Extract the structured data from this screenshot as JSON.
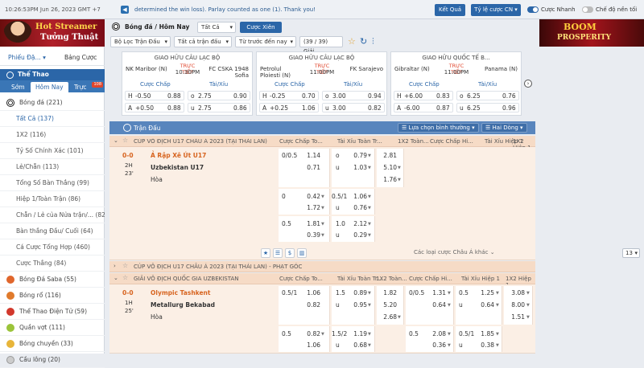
{
  "topbar": {
    "time": "10:26:53PM Jun 26, 2023 GMT +7",
    "marquee": "determined the win loss). Parlay counted as one (1). Thank you!",
    "result_btn": "Kết Quả",
    "odds_type": "Tỷ lệ cược CN",
    "fast_bet": "Cược Nhanh",
    "lite_mode": "Chế độ nền tối"
  },
  "banners": {
    "left_line1": "Hot Streamer",
    "left_line2": "Tưởng Thuật",
    "right_line1": "BOOM",
    "right_line2": "PROSPERITY"
  },
  "sidebar": {
    "tab1": "Phiếu Đặ...",
    "tab2": "Bảng Cược",
    "sport_head": "Thể Thao",
    "subtabs": [
      "Sớm",
      "Hôm Nay",
      "Trực tiếp"
    ],
    "live_badge": "108",
    "soccer": "Bóng đá (221)",
    "items": [
      "Tất Cả (137)",
      "1X2 (116)",
      "Tỷ Số Chính Xác (101)",
      "Lẻ/Chẵn (113)",
      "Tổng Số Bàn Thắng (99)",
      "Hiệp 1/Toàn Trận (86)",
      "Chẵn / Lẻ của Nửa trận/... (82)",
      "Bàn thắng Đầu/ Cuối (64)",
      "Cá Cược Tổng Hợp (460)",
      "Cược Thắng (84)"
    ],
    "sports": [
      "Bóng Đá Saba (55)",
      "Bóng rổ (116)",
      "Thể Thao Điện Tử (59)",
      "Quần vợt (111)",
      "Bóng chuyền (33)",
      "Cầu lông (20)"
    ]
  },
  "filters": {
    "sport": "Bóng đá / Hôm Nay",
    "all": "Tất Cả",
    "parlay": "Cược Xiên",
    "league_filter": "Bộ Lọc Trận Đấu",
    "all_bets": "Tất cả trận đấu",
    "sort": "Từ trước đến nay",
    "count": "(39 / 39) Giải"
  },
  "cards": [
    {
      "league": "GIAO HỮU CÂU LẠC BỘ",
      "home": "NK Maribor (N)",
      "away": "FC CSKA 1948 Sofia",
      "live": "TRỰC TIẾP",
      "time": "10:30PM",
      "h_label": "Cược Chấp",
      "ou_label": "Tài/Xỉu",
      "r1": [
        "H",
        "-0.50",
        "0.88",
        "o",
        "2.75",
        "0.90"
      ],
      "r2": [
        "A",
        "+0.50",
        "0.88",
        "u",
        "2.75",
        "0.86"
      ]
    },
    {
      "league": "GIAO HỮU CÂU LẠC BỘ",
      "home": "Petrolul Ploiesti (N)",
      "away": "FK Sarajevo",
      "live": "TRỰC TIẾP",
      "time": "11:00PM",
      "h_label": "Cược Chấp",
      "ou_label": "Tài/Xỉu",
      "r1": [
        "H",
        "-0.25",
        "0.70",
        "o",
        "3.00",
        "0.94"
      ],
      "r2": [
        "A",
        "+0.25",
        "1.06",
        "u",
        "3.00",
        "0.82"
      ]
    },
    {
      "league": "GIAO HỮU QUỐC TẾ B...",
      "home": "Gibraltar (N)",
      "away": "Panama (N)",
      "live": "TRỰC TIẾP",
      "time": "11:00PM",
      "h_label": "Cược Chấp",
      "ou_label": "Tài/Xỉu",
      "r1": [
        "H",
        "+6.00",
        "0.83",
        "o",
        "6.25",
        "0.76"
      ],
      "r2": [
        "A",
        "-6.00",
        "0.87",
        "u",
        "6.25",
        "0.96"
      ]
    }
  ],
  "table": {
    "title": "Trận Đấu",
    "select_btn": "Lựa chọn bình thường",
    "lines_btn": "Hai Dòng",
    "cols": [
      "Cược Chấp To...",
      "Tài Xỉu Toàn Tr...",
      "1X2 Toàn...",
      "Cược Chấp Hi...",
      "Tài Xỉu Hiệp 1",
      "1X2 Hiệp 1"
    ],
    "league1": "CÚP VÔ ĐỊCH U17 CHÂU Á 2023 (TẠI THÁI LAN)",
    "league2": "CÚP VÔ ĐỊCH U17 CHÂU Á 2023 (TẠI THÁI LAN) - PHẠT GÓC",
    "league3": "GIẢI VÔ ĐỊCH QUỐC GIA UZBEKISTAN",
    "more": "Các loại cược Châu Á khác",
    "page": "13",
    "m1": {
      "score": "0-0",
      "half": "2H",
      "minute": "23'",
      "home": "Ả Rập Xê Út U17",
      "away": "Uzbekistan U17",
      "draw": "Hòa",
      "l1": [
        "0/0.5",
        "1.14",
        "o",
        "0.79",
        "2.81"
      ],
      "l2": [
        "",
        "0.71",
        "u",
        "1.03",
        "5.10"
      ],
      "l3": [
        "1.76"
      ],
      "l4": [
        "0",
        "0.42",
        "0.5/1",
        "1.06"
      ],
      "l5": [
        "",
        "1.72",
        "u",
        "0.76"
      ],
      "l6": [
        "0.5",
        "1.81",
        "1.0",
        "2.12"
      ],
      "l7": [
        "",
        "0.39",
        "u",
        "0.29"
      ]
    },
    "m2": {
      "score": "0-0",
      "half": "1H",
      "minute": "25'",
      "home": "Olympic Tashkent",
      "away": "Metallurg Bekabad",
      "draw": "Hòa",
      "l1": [
        "0.5/1",
        "1.06",
        "1.5",
        "0.89",
        "1.82",
        "0/0.5",
        "1.31",
        "1.25",
        "3.08"
      ],
      "l2": [
        "",
        "0.82",
        "u",
        "0.95",
        "5.20",
        "",
        "0.64",
        "u",
        "0.64",
        "8.00"
      ],
      "l3": [
        "2.68",
        "1.51"
      ],
      "l4": [
        "0.5",
        "0.82",
        "1.5/2",
        "1.19",
        "0.5",
        "2.08",
        "0.5/1",
        "1.85"
      ],
      "l5": [
        "",
        "1.06",
        "u",
        "0.68",
        "",
        "0.36",
        "u",
        "0.38"
      ]
    }
  },
  "colors": {
    "primary": "#2b66a8",
    "table_head": "#5885bd",
    "league_bg": "#f6dbc6",
    "favorite": "#d7641f"
  }
}
